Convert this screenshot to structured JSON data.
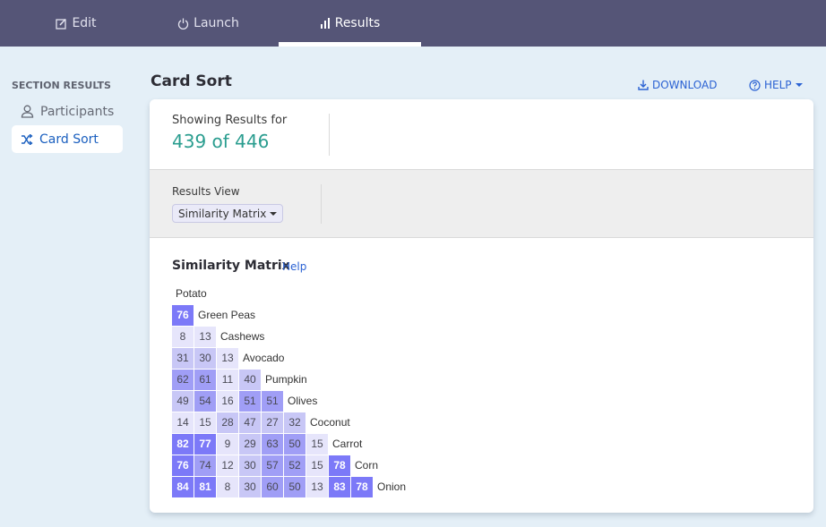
{
  "topnav": {
    "tabs": [
      {
        "label": "Edit",
        "icon": "edit-icon",
        "active": false
      },
      {
        "label": "Launch",
        "icon": "power-icon",
        "active": false
      },
      {
        "label": "Results",
        "icon": "bar-chart-icon",
        "active": true
      }
    ]
  },
  "sidebar": {
    "heading": "SECTION RESULTS",
    "items": [
      {
        "label": "Participants",
        "icon": "user-icon",
        "active": false
      },
      {
        "label": "Card Sort",
        "icon": "shuffle-icon",
        "active": true
      }
    ]
  },
  "header": {
    "title": "Card Sort",
    "download_label": "DOWNLOAD",
    "help_label": "HELP"
  },
  "summary": {
    "label": "Showing Results for",
    "value": "439 of 446"
  },
  "results_view": {
    "label": "Results View",
    "selected": "Similarity Matrix"
  },
  "matrix": {
    "title": "Similarity Matrix",
    "help_label": "Help",
    "colors": {
      "l0": "#e6e5fb",
      "l1": "#c8c7f6",
      "l2": "#a09ef6",
      "l3": "#7c79f8"
    },
    "first_label": "Potato",
    "rows": [
      {
        "label": "Green Peas",
        "values": [
          76
        ]
      },
      {
        "label": "Cashews",
        "values": [
          8,
          13
        ]
      },
      {
        "label": "Avocado",
        "values": [
          31,
          30,
          13
        ]
      },
      {
        "label": "Pumpkin",
        "values": [
          62,
          61,
          11,
          40
        ]
      },
      {
        "label": "Olives",
        "values": [
          49,
          54,
          16,
          51,
          51
        ]
      },
      {
        "label": "Coconut",
        "values": [
          14,
          15,
          28,
          47,
          27,
          32
        ]
      },
      {
        "label": "Carrot",
        "values": [
          82,
          77,
          9,
          29,
          63,
          50,
          15
        ]
      },
      {
        "label": "Corn",
        "values": [
          76,
          74,
          12,
          30,
          57,
          52,
          15,
          78
        ]
      },
      {
        "label": "Onion",
        "values": [
          84,
          81,
          8,
          30,
          60,
          50,
          13,
          83,
          78
        ]
      }
    ]
  }
}
